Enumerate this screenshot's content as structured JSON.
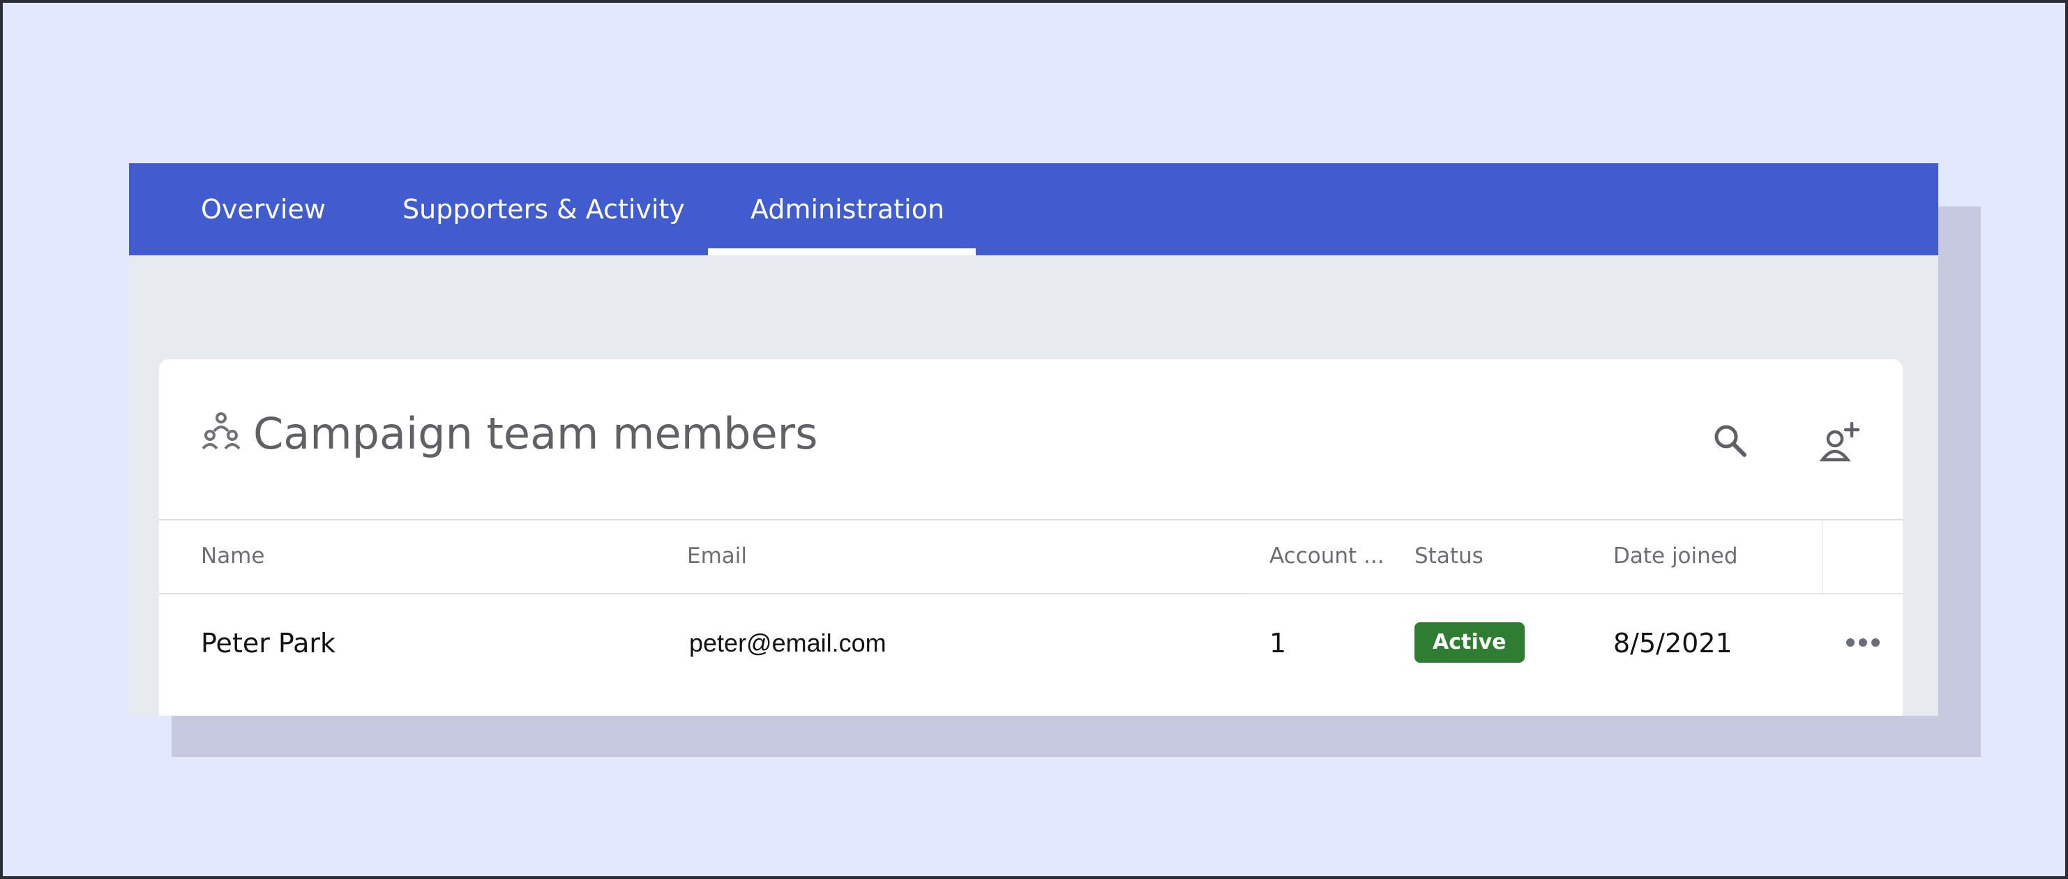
{
  "tabs": [
    {
      "label": "Overview",
      "active": false
    },
    {
      "label": "Supporters & Activity",
      "active": false
    },
    {
      "label": "Administration",
      "active": true
    }
  ],
  "card": {
    "title": "Campaign team members",
    "icons": {
      "title": "team-icon",
      "search": "search-icon",
      "add": "add-user-icon",
      "more": "more-horizontal-icon"
    }
  },
  "table": {
    "columns": [
      "Name",
      "Email",
      "Account ...",
      "Status",
      "Date joined"
    ],
    "rows": [
      {
        "name": "Peter Park",
        "email": "peter@email.com",
        "account": "1",
        "status": "Active",
        "date_joined": "8/5/2021"
      }
    ]
  },
  "colors": {
    "tabbar": "#405ccf",
    "page_background": "#e2e8fe",
    "status_active": "#2f7d32"
  }
}
